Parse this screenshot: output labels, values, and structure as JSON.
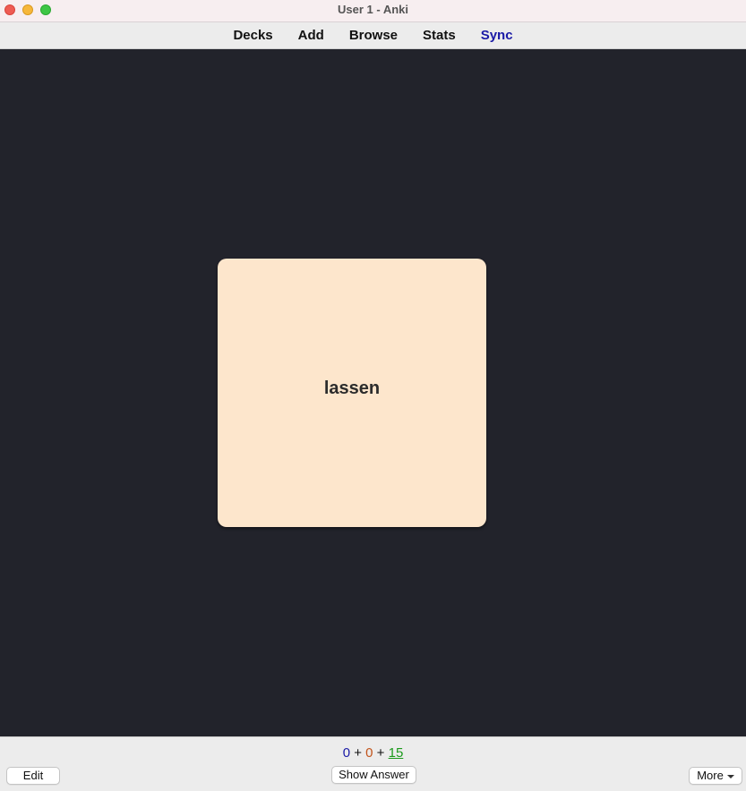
{
  "window": {
    "title": "User 1 - Anki"
  },
  "toolbar": {
    "decks": "Decks",
    "add": "Add",
    "browse": "Browse",
    "stats": "Stats",
    "sync": "Sync",
    "sync_color": "#1a1aa6"
  },
  "card": {
    "front_text": "lassen",
    "background_color": "#fde6cc"
  },
  "counts": {
    "new": "0",
    "plus1": "+",
    "learning": "0",
    "plus2": "+",
    "review": "15",
    "new_color": "#1a1aa6",
    "learning_color": "#c2541b",
    "review_color": "#1c9a1c"
  },
  "bottom": {
    "edit_label": "Edit",
    "show_answer_label": "Show Answer",
    "more_label": "More",
    "more_icon": "chevron-down-icon"
  },
  "titlebar_buttons": {
    "close_icon": "close-icon",
    "minimize_icon": "minimize-icon",
    "maximize_icon": "maximize-icon"
  }
}
